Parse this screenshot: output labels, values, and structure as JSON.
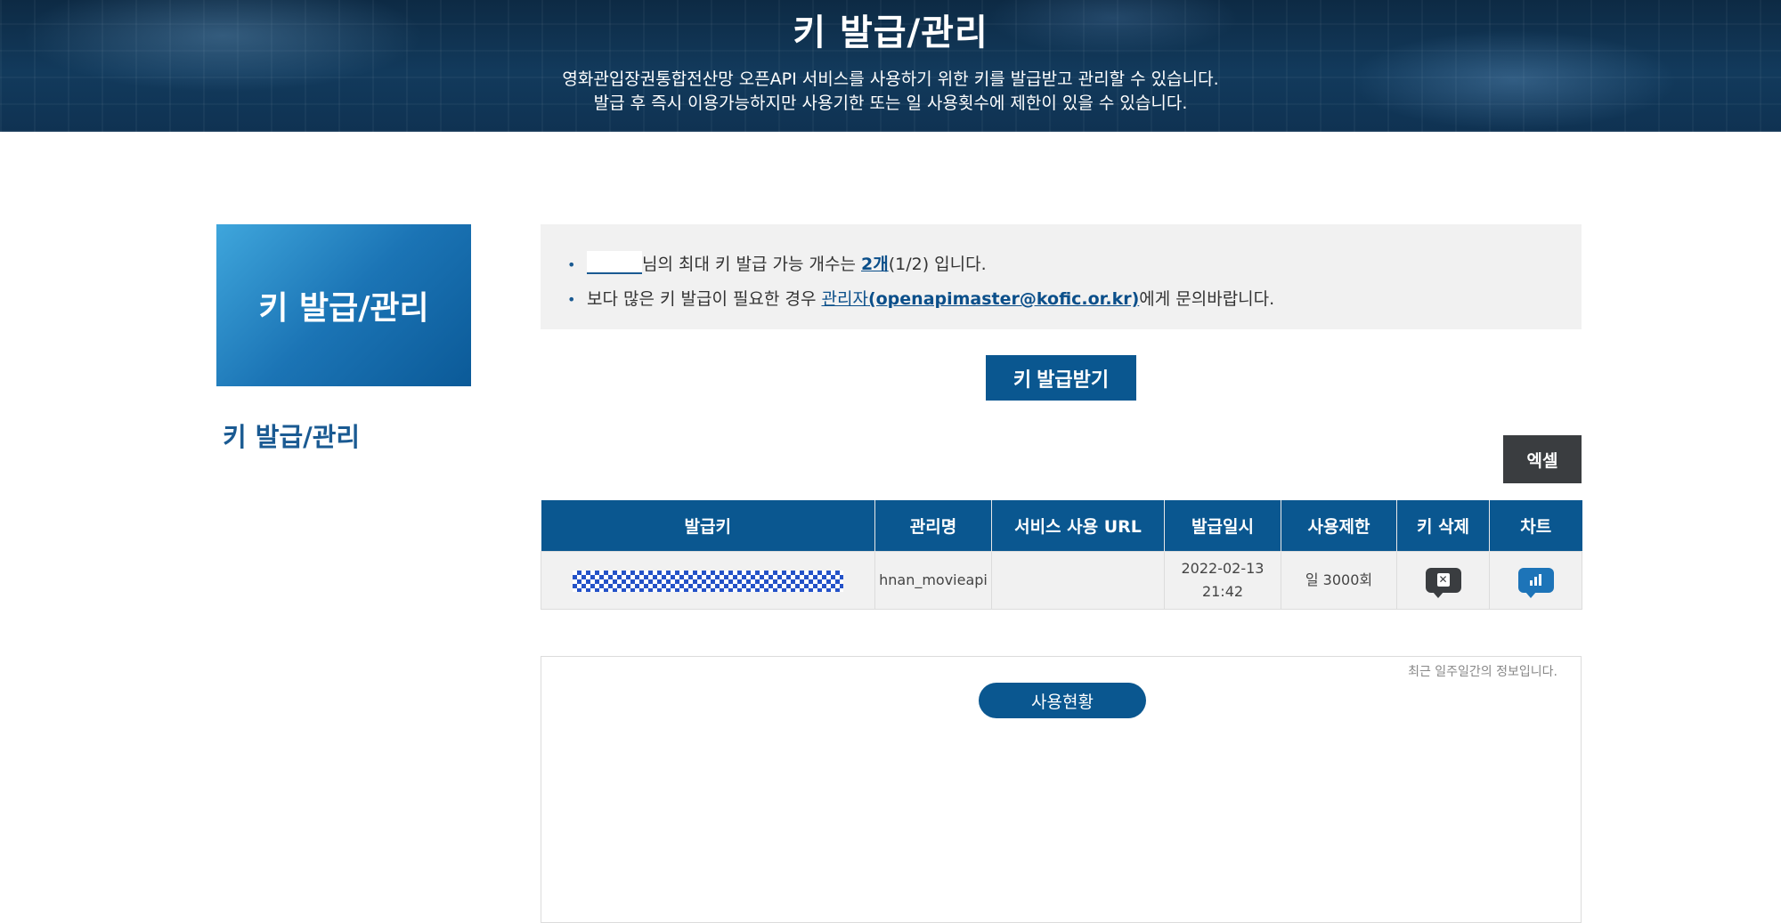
{
  "hero": {
    "title": "키 발급/관리",
    "line1": "영화관입장권통합전산망 오픈API 서비스를 사용하기 위한 키를 발급받고 관리할 수 있습니다.",
    "line2": "발급 후 즉시 이용가능하지만 사용기한 또는 일 사용횟수에 제한이 있을 수 있습니다."
  },
  "sidebar": {
    "box_title": "키 발급/관리",
    "link": "키 발급/관리"
  },
  "notice": {
    "line1_suffix": "님의 최대 키 발급 가능 개수는 ",
    "line1_count": "2개",
    "line1_tail": "(1/2) 입니다.",
    "line2_prefix": "보다 많은 키 발급이 필요한 경우 ",
    "line2_link_a": "관리자",
    "line2_link_b": "(openapimaster@kofic.or.kr)",
    "line2_tail": "에게 문의바랍니다."
  },
  "issue_button": "키 발급받기",
  "excel_button": "엑셀",
  "table": {
    "headers": [
      "발급키",
      "관리명",
      "서비스 사용 URL",
      "발급일시",
      "사용제한",
      "키 삭제",
      "차트"
    ],
    "rows": [
      {
        "key": "",
        "name": "hnan_movieapi",
        "url": "",
        "date": "2022-02-13",
        "time": "21:42",
        "limit": "일 3000회"
      }
    ]
  },
  "usage": {
    "note": "최근 일주일간의 정보입니다.",
    "button": "사용현황"
  },
  "colors": {
    "primary": "#0a5790",
    "dark_button": "#3a3d40",
    "panel_bg": "#f1f1f1"
  }
}
